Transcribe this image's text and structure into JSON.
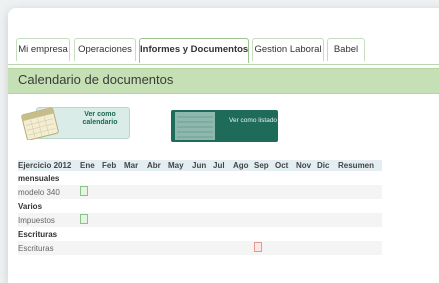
{
  "tabs": [
    {
      "label": "Mi empresa",
      "active": false
    },
    {
      "label": "Operaciones",
      "active": false
    },
    {
      "label": "Informes y Documentos",
      "active": true
    },
    {
      "label": "Gestion Laboral",
      "active": false
    },
    {
      "label": "Babel",
      "active": false
    }
  ],
  "section": {
    "title": "Calendario de documentos"
  },
  "view_buttons": {
    "calendar_label": "Ver como calendario",
    "list_label": "Ver como listado"
  },
  "table": {
    "columns": [
      "Ejercicio 2012",
      "Ene",
      "Feb",
      "Mar",
      "Abr",
      "May",
      "Jun",
      "Jul",
      "Ago",
      "Sep",
      "Oct",
      "Nov",
      "Dic",
      "Resumen"
    ],
    "groups": [
      {
        "name": "mensuales",
        "rows": [
          {
            "label": "modelo 340",
            "icon_month": "Ene",
            "icon": "green-doc-icon"
          }
        ]
      },
      {
        "name": "Varios",
        "rows": [
          {
            "label": "Impuestos",
            "icon_month": "Ene",
            "icon": "green-doc-icon"
          }
        ]
      },
      {
        "name": "Escrituras",
        "rows": [
          {
            "label": "Escrituras",
            "icon_month": "Sep",
            "icon": "red-pdf-icon"
          }
        ]
      }
    ]
  },
  "colors": {
    "accent": "#c6e0b5",
    "tab_border": "#9dc38e",
    "list_button": "#1f6b5a"
  }
}
